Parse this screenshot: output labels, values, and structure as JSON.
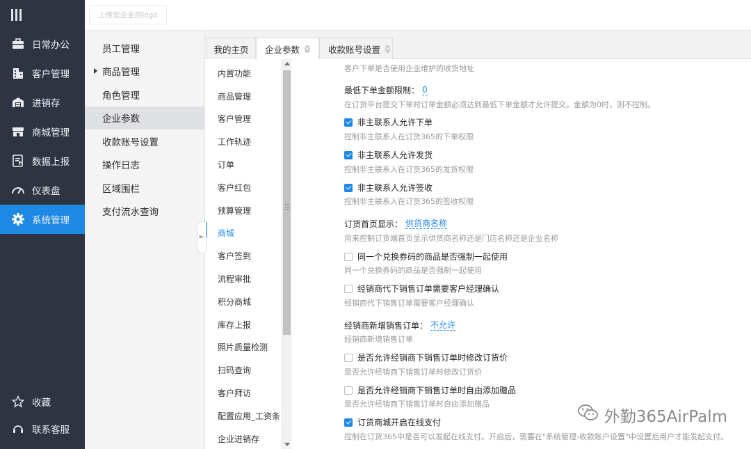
{
  "nav": {
    "items": [
      {
        "label": "日常办公",
        "icon": "briefcase-icon"
      },
      {
        "label": "客户管理",
        "icon": "building-icon"
      },
      {
        "label": "进销存",
        "icon": "warehouse-icon"
      },
      {
        "label": "商城管理",
        "icon": "store-icon"
      },
      {
        "label": "数据上报",
        "icon": "report-icon"
      },
      {
        "label": "仪表盘",
        "icon": "gauge-icon"
      },
      {
        "label": "系统管理",
        "icon": "gear-icon"
      }
    ],
    "bottom": [
      {
        "label": "收藏",
        "icon": "star-icon"
      },
      {
        "label": "联系客服",
        "icon": "headset-icon"
      }
    ],
    "accent": "#1e88e5"
  },
  "topbar": {
    "logo_placeholder": "上传您企业的logo"
  },
  "submenu": {
    "items": [
      "员工管理",
      "商品管理",
      "角色管理",
      "企业参数",
      "收款账号设置",
      "操作日志",
      "区域围栏",
      "支付流水查询"
    ]
  },
  "tabs": [
    {
      "label": "我的主页"
    },
    {
      "label": "企业参数"
    },
    {
      "label": "收款账号设置"
    }
  ],
  "categories": [
    "内置功能",
    "商品管理",
    "客户管理",
    "工作轨迹",
    "订单",
    "客户红包",
    "预算管理",
    "商城",
    "客户签到",
    "流程审批",
    "积分商城",
    "库存上报",
    "照片质量检测",
    "扫码查询",
    "客户拜访",
    "配置应用_工资条",
    "企业进销存"
  ],
  "settings": {
    "top_hint": "客户下单是否使用企业维护的收货地址",
    "min_order_label": "最低下单金额限制：",
    "min_order_value": "0",
    "min_order_hint": "在订货平台提交下单时订单金额必须达到最低下单金额才允许提交。金额为0时，则不控制。",
    "cb1_label": "非主联系人允许下单",
    "cb1_hint": "控制非主联系人在订货365的下单权限",
    "cb2_label": "非主联系人允许发货",
    "cb2_hint": "控制非主联系人在订货365的发货权限",
    "cb3_label": "非主联系人允许签收",
    "cb3_hint": "控制非主联系人在订货365的签收权限",
    "home_label": "订货首页显示：",
    "home_value": "供货商名称",
    "home_hint": "用来控制订货端首页显示供货商名称还是门店名称还是企业名称",
    "cb4_label": "同一个兑换券码的商品是否强制一起使用",
    "cb4_hint": "同一个兑换券码的商品是否强制一起使用",
    "cb5_label": "经销商代下销售订单需要客户经理确认",
    "cb5_hint": "经销商代下销售订单需要客户经理确认",
    "dealer_label": "经销商新增销售订单：",
    "dealer_value": "不允许",
    "dealer_hint": "经销商新增销售订单",
    "cb6_label": "是否允许经销商下销售订单时修改订货价",
    "cb6_hint": "是否允许经销商下销售订单时修改订货价",
    "cb7_label": "是否允许经销商下销售订单时自由添加赠品",
    "cb7_hint": "是否允许经销商下销售订单时自由添加赠品",
    "cb8_label": "订货商城开启在线支付",
    "cb8_hint": "控制在订货365中是否可以发起在线支付。开启后，需要在\"系统管理-收款账户设置\"中设置后用户才能发起支付。"
  },
  "watermark": "外勤365AirPalm"
}
